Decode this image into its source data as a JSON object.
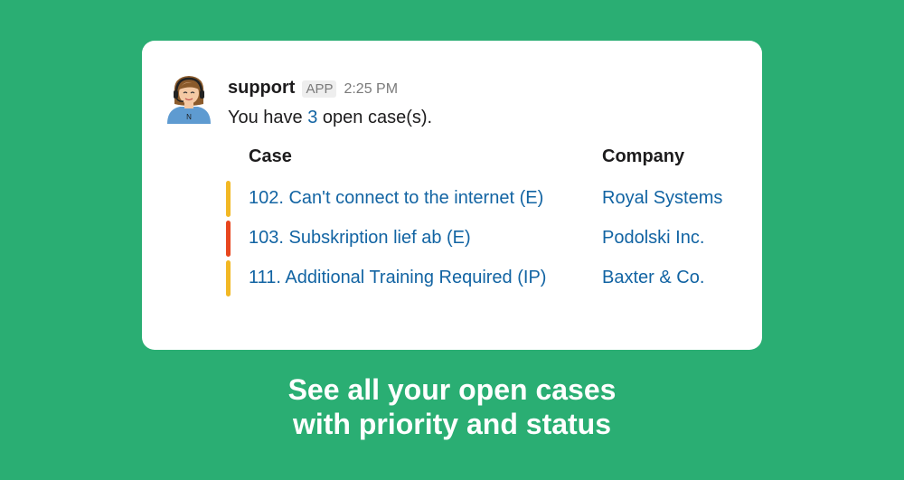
{
  "message": {
    "sender": "support",
    "badge": "APP",
    "time": "2:25 PM",
    "text_prefix": "You have ",
    "count": "3",
    "text_suffix": " open case(s)."
  },
  "table": {
    "headers": {
      "case": "Case",
      "company": "Company"
    },
    "rows": [
      {
        "case": "102. Can't connect to the internet (E)",
        "company": "Royal Systems",
        "priority_color": "#f2b824"
      },
      {
        "case": "103. Subskription lief ab (E)",
        "company": "Podolski Inc.",
        "priority_color": "#e8461e"
      },
      {
        "case": "111. Additional Training Required (IP)",
        "company": "Baxter & Co.",
        "priority_color": "#f2b824"
      }
    ]
  },
  "caption": {
    "line1": "See all your open cases",
    "line2": "with priority and status"
  },
  "colors": {
    "background": "#2aae73",
    "link": "#1264a3"
  },
  "avatar": {
    "icon": "support-agent-avatar-icon",
    "label": "N"
  }
}
